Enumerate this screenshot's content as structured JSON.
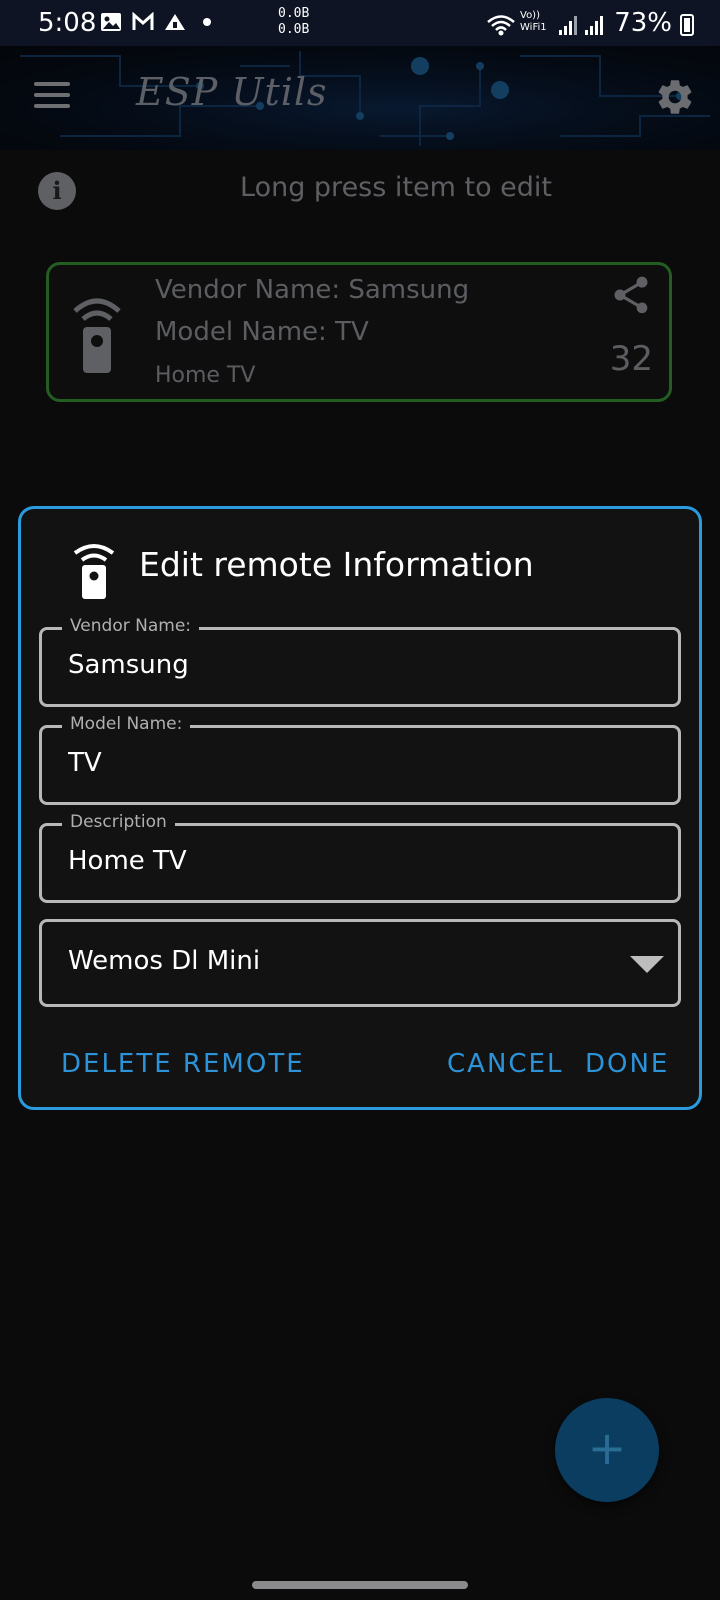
{
  "status_bar": {
    "time": "5:08",
    "speed_up": "0.0B",
    "speed_down": "0.0B",
    "network_label_top": "Vo))",
    "network_label_bottom": "WiFi1",
    "battery": "73%"
  },
  "app_bar": {
    "title": "ESP Utils",
    "menu_icon": "menu-icon",
    "settings_icon": "gear-icon"
  },
  "hint": {
    "icon": "info-icon",
    "text": "Long press item to edit"
  },
  "remote_card": {
    "vendor": "Vendor Name: Samsung",
    "model": "Model Name:   TV",
    "description": "Home TV",
    "count": "32",
    "accent_color": "#245d22"
  },
  "dialog": {
    "title": "Edit remote Information",
    "fields": {
      "vendor": {
        "label": "Vendor Name:",
        "value": "Samsung"
      },
      "model": {
        "label": "Model Name:",
        "value": "TV"
      },
      "description": {
        "label": "Description",
        "value": "Home TV"
      }
    },
    "board_select": {
      "value": "Wemos Dl Mini"
    },
    "buttons": {
      "delete": "DELETE REMOTE",
      "cancel": "CANCEL",
      "done": "DONE"
    },
    "accent_color": "#2b9be0"
  },
  "fab": {
    "icon": "plus-icon",
    "label": "+"
  }
}
